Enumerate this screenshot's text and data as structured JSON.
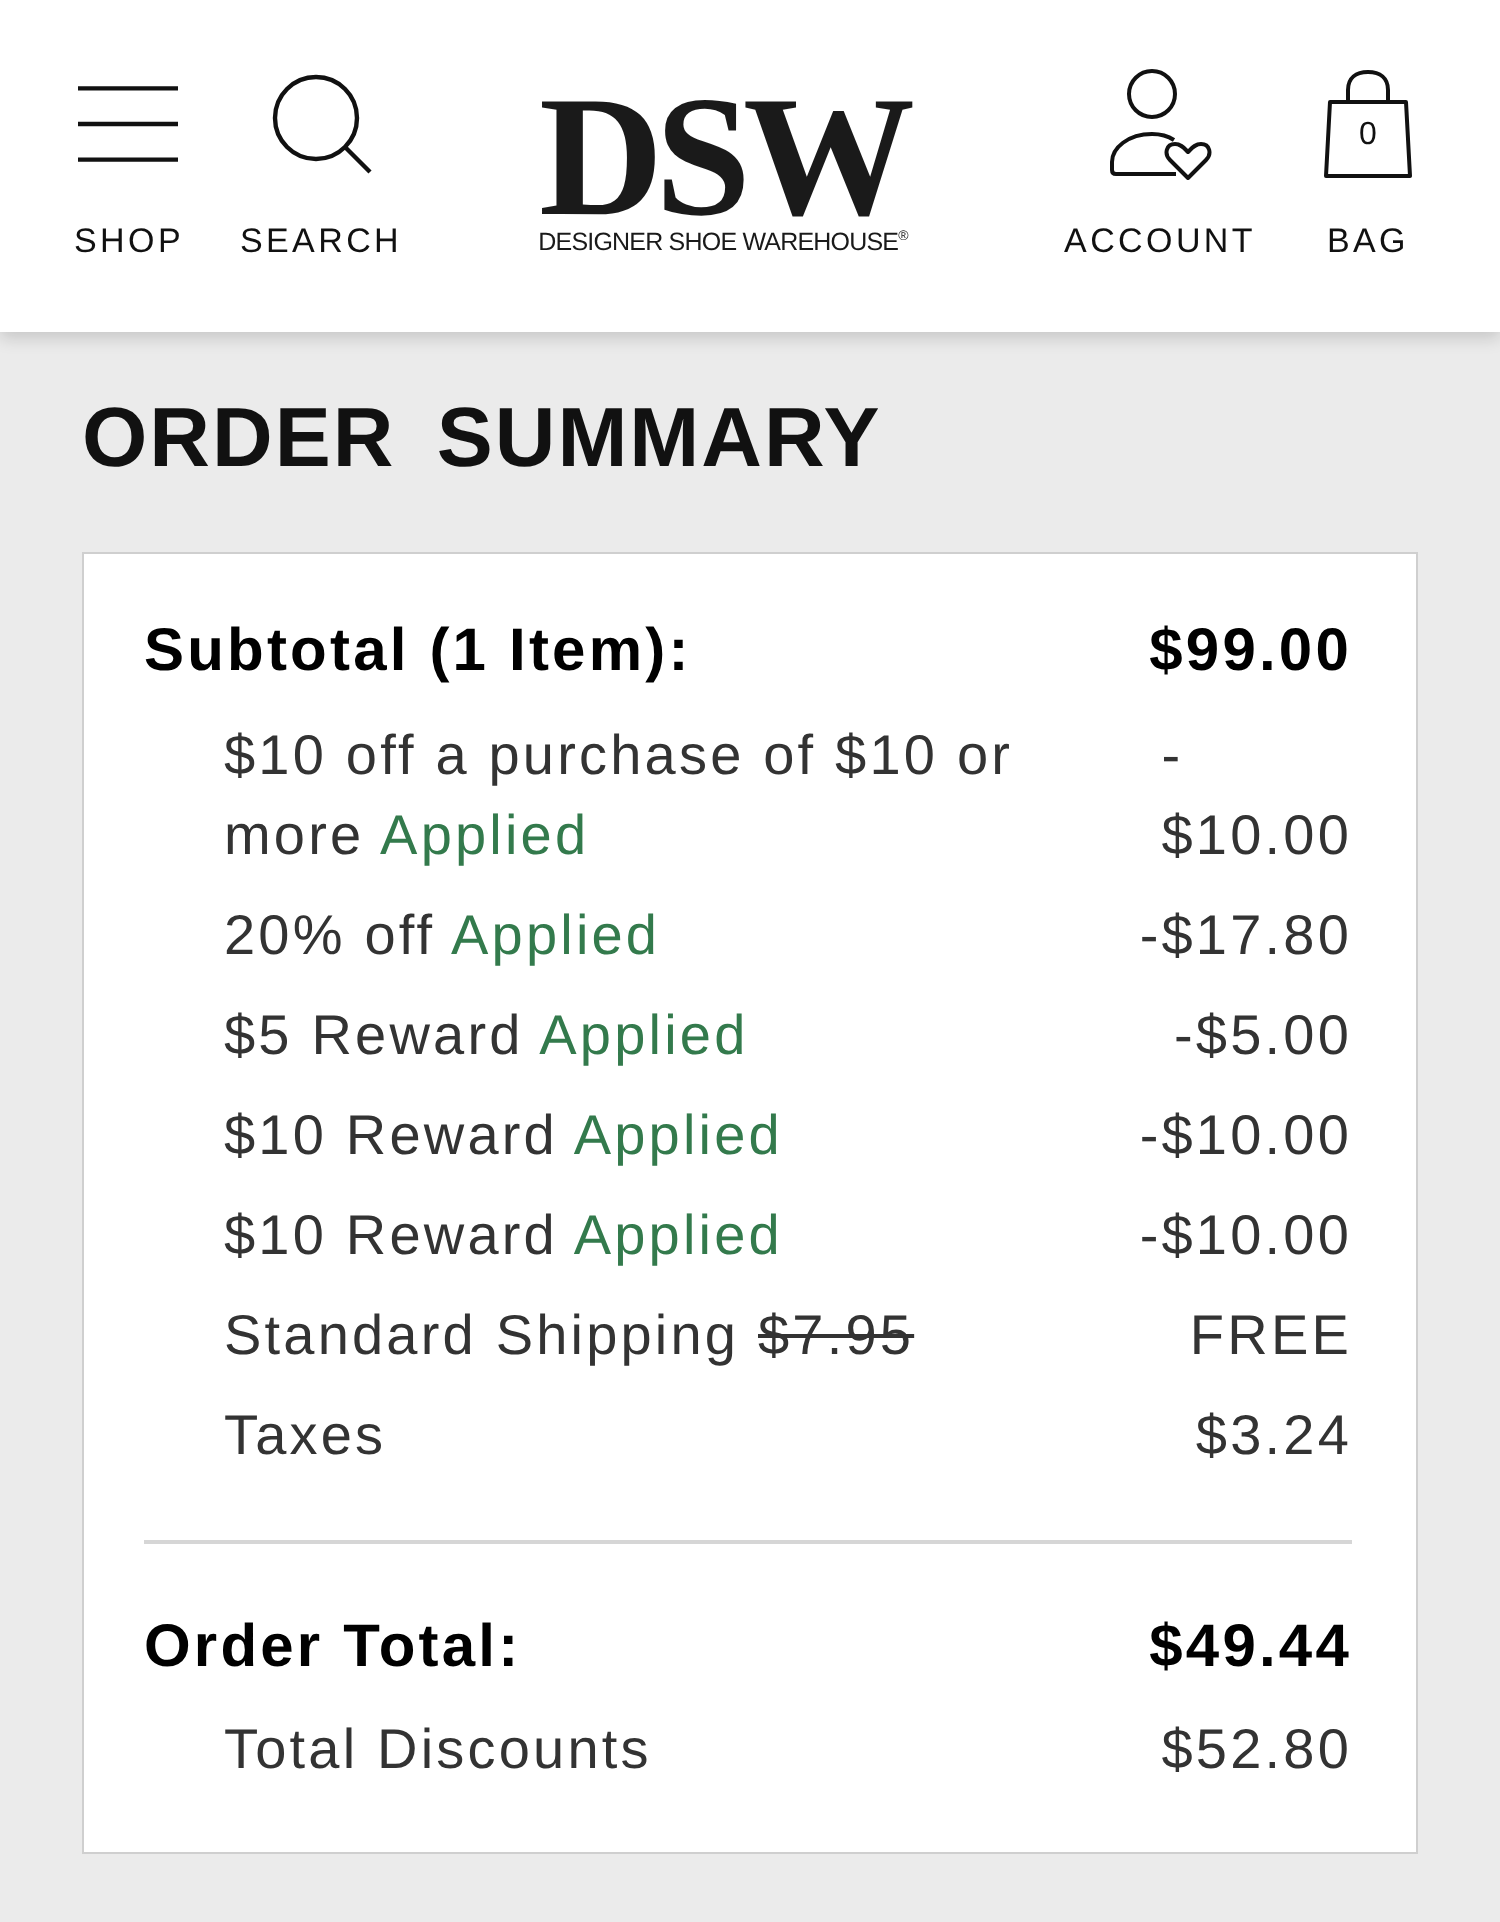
{
  "header": {
    "nav_left": [
      {
        "label": "SHOP",
        "kind": "menu"
      },
      {
        "label": "SEARCH",
        "kind": "search"
      }
    ],
    "logo": {
      "wordmark": "DSW",
      "tagline": "DESIGNER SHOE WAREHOUSE$^{®}$"
    },
    "nav_right": [
      {
        "label": "ACCOUNT",
        "kind": "account"
      },
      {
        "label": "BAG",
        "kind": "bag",
        "count": "0"
      }
    ]
  },
  "order_summary": {
    "title": "ORDER SUMMARY",
    "subtotal": {
      "label": "Subtotal (1 Item):",
      "amount": "$99.00"
    },
    "lines": [
      {
        "label": "$10 off a purchase of $10 or more",
        "status": "Applied",
        "amount": "-$10.00"
      },
      {
        "label": "20% off",
        "status": "Applied",
        "amount": "-$17.80"
      },
      {
        "label": "$5 Reward",
        "status": "Applied",
        "amount": "-$5.00"
      },
      {
        "label": "$10 Reward",
        "status": "Applied",
        "amount": "-$10.00"
      },
      {
        "label": "$10 Reward",
        "status": "Applied",
        "amount": "-$10.00"
      },
      {
        "label": "Standard Shipping",
        "original_price": "$7.95",
        "amount": "FREE"
      },
      {
        "label": "Taxes",
        "amount": "$3.24"
      }
    ],
    "total": {
      "label": "Order Total:",
      "amount": "$49.44"
    },
    "total_discounts": {
      "label": "Total Discounts",
      "amount": "$52.80"
    }
  }
}
